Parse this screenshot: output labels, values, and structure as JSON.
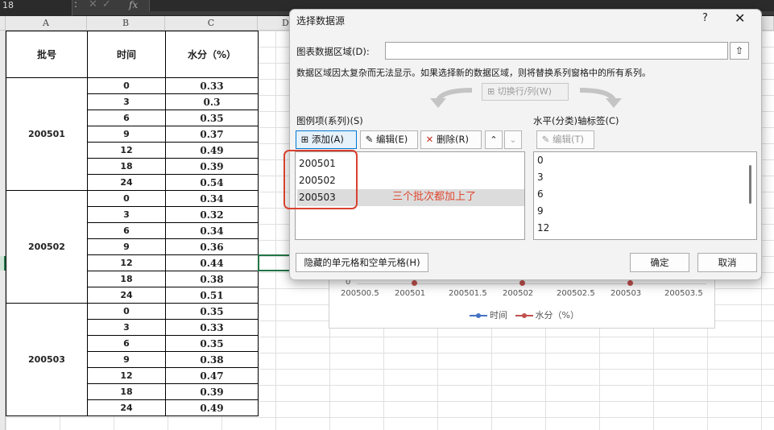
{
  "formula_bar": {
    "name_box": "18",
    "fx": "fx",
    "cancel": "✕",
    "confirm": "✓"
  },
  "columns": [
    "A",
    "B",
    "C",
    "D"
  ],
  "table": {
    "headers": [
      "批号",
      "时间",
      "水分（%）"
    ],
    "groups": [
      {
        "batch": "200501",
        "rows": [
          [
            "0",
            "0.33"
          ],
          [
            "3",
            "0.3"
          ],
          [
            "6",
            "0.35"
          ],
          [
            "9",
            "0.37"
          ],
          [
            "12",
            "0.49"
          ],
          [
            "18",
            "0.39"
          ],
          [
            "24",
            "0.54"
          ]
        ]
      },
      {
        "batch": "200502",
        "rows": [
          [
            "0",
            "0.34"
          ],
          [
            "3",
            "0.32"
          ],
          [
            "6",
            "0.34"
          ],
          [
            "9",
            "0.36"
          ],
          [
            "12",
            "0.44"
          ],
          [
            "18",
            "0.38"
          ],
          [
            "24",
            "0.51"
          ]
        ]
      },
      {
        "batch": "200503",
        "rows": [
          [
            "0",
            "0.35"
          ],
          [
            "3",
            "0.33"
          ],
          [
            "6",
            "0.35"
          ],
          [
            "9",
            "0.38"
          ],
          [
            "12",
            "0.47"
          ],
          [
            "18",
            "0.39"
          ],
          [
            "24",
            "0.49"
          ]
        ]
      }
    ]
  },
  "chart": {
    "y_zero_label": "0",
    "x_labels": [
      "200500.5",
      "200501",
      "200501.5",
      "200502",
      "200502.5",
      "200503",
      "200503.5"
    ],
    "x_values": [
      200500.5,
      200501,
      200501.5,
      200502,
      200502.5,
      200503,
      200503.5
    ],
    "points_x": [
      200501,
      200502,
      200503
    ],
    "legend": [
      {
        "name": "时间",
        "color": "#4472c4"
      },
      {
        "name": "水分（%）",
        "color": "#c0504d"
      }
    ]
  },
  "dialog": {
    "title": "选择数据源",
    "help": "?",
    "close": "✕",
    "range_label": "图表数据区域(D):",
    "range_value": "",
    "note": "数据区域因太复杂而无法显示。如果选择新的数据区域，则将替换系列窗格中的所有系列。",
    "switch_label": "切换行/列(W)",
    "legend_label": "图例项(系列)(S)",
    "axis_label": "水平(分类)轴标签(C)",
    "add_label": "添加(A)",
    "edit_label": "编辑(E)",
    "delete_label": "删除(R)",
    "axis_edit_label": "编辑(T)",
    "series": [
      "200501",
      "200502",
      "200503"
    ],
    "axis_items": [
      "0",
      "3",
      "6",
      "9",
      "12"
    ],
    "hidden_cells_label": "隐藏的单元格和空单元格(H)",
    "ok_label": "确定",
    "cancel_label": "取消"
  },
  "annotation": "三个批次都加上了",
  "colors": {
    "accent": "#0078d4",
    "annotation": "#e0472f",
    "excel_green": "#217346"
  }
}
